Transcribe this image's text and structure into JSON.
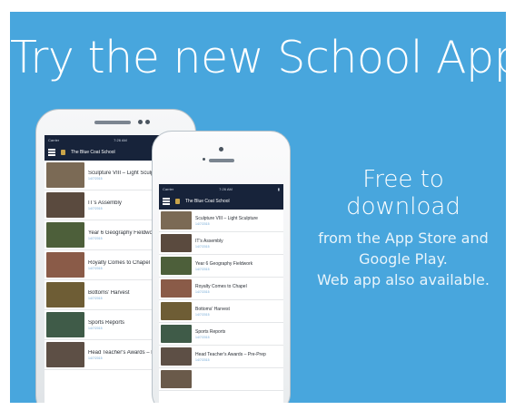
{
  "headline": "Try the new School App",
  "side": {
    "big": "Free to download",
    "line1": "from the App Store and",
    "line2": "Google Play.",
    "line3": "Web app also available."
  },
  "phone": {
    "carrier": "Carrier",
    "time": "7:26 AM",
    "school": "The Blue Coat School"
  },
  "items_back": [
    {
      "title": "Sculpture VIII – Light Sculpture",
      "date": "14/7/2015",
      "color": "#7b6a55"
    },
    {
      "title": "IT's Assembly",
      "date": "14/7/2015",
      "color": "#5a4a3e"
    },
    {
      "title": "Year 6 Geography Fieldwork",
      "date": "14/7/2015",
      "color": "#4d5f3a"
    },
    {
      "title": "Royalty Comes to Chapel",
      "date": "14/7/2015",
      "color": "#8a5b48"
    },
    {
      "title": "Bottoms' Harvest",
      "date": "14/7/2015",
      "color": "#6e5d35"
    },
    {
      "title": "Sports Reports",
      "date": "14/7/2015",
      "color": "#3f5b48"
    },
    {
      "title": "Head Teacher's Awards – Pre-Prep",
      "date": "14/7/2015",
      "color": "#5d4f45"
    }
  ],
  "items_front": [
    {
      "title": "Sculpture VIII – Light Sculpture",
      "date": "14/7/2015",
      "color": "#7b6a55"
    },
    {
      "title": "IT's Assembly",
      "date": "14/7/2015",
      "color": "#5a4a3e"
    },
    {
      "title": "Year 6 Geography Fieldwork",
      "date": "14/7/2015",
      "color": "#4d5f3a"
    },
    {
      "title": "Royalty Comes to Chapel",
      "date": "14/7/2015",
      "color": "#8a5b48"
    },
    {
      "title": "Bottoms' Harvest",
      "date": "14/7/2015",
      "color": "#6e5d35"
    },
    {
      "title": "Sports Reports",
      "date": "14/7/2015",
      "color": "#3f5b48"
    },
    {
      "title": "Head Teacher's Awards – Pre-Prep",
      "date": "14/7/2015",
      "color": "#5d4f45"
    },
    {
      "title": "",
      "date": "",
      "color": "#6a5a4a"
    }
  ]
}
